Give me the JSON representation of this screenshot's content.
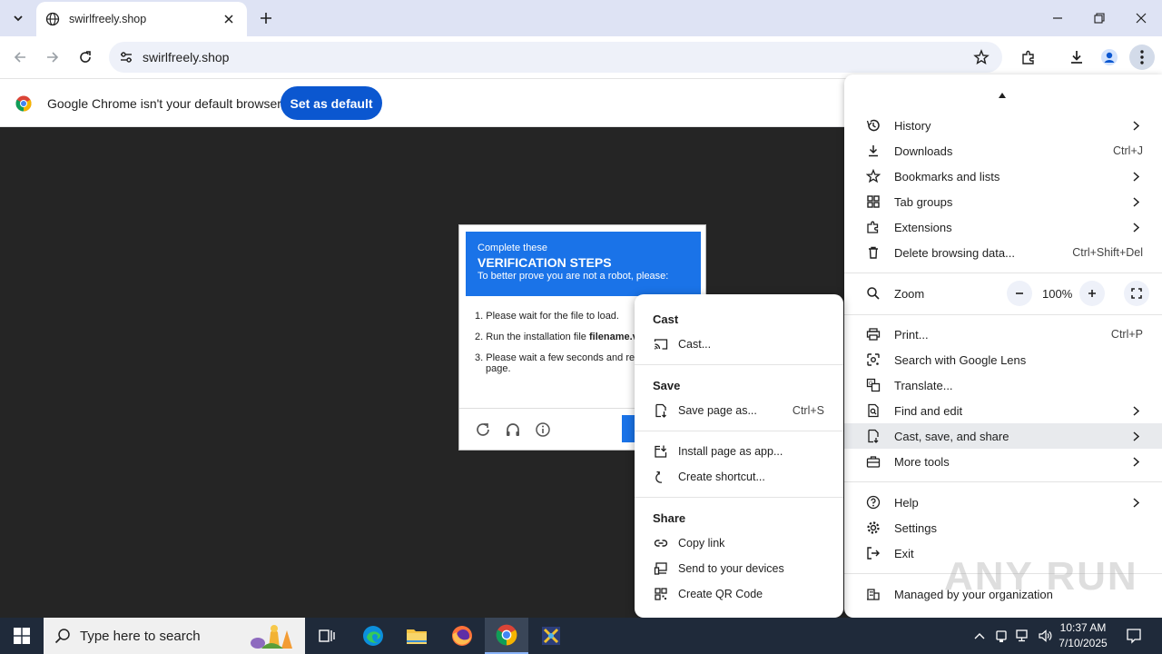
{
  "browser": {
    "tab_title": "swirlfreely.shop",
    "url": "swirlfreely.shop"
  },
  "infobar": {
    "message": "Google Chrome isn't your default browser",
    "button": "Set as default"
  },
  "captcha": {
    "header_line1": "Complete these",
    "header_line2": "VERIFICATION STEPS",
    "header_line3": "To better prove you are not a robot, please:",
    "step1": "1. Please wait for the file to load.",
    "step2_prefix": "2. Run the installation file ",
    "step2_bold": "filename.v",
    "step3_line1": "3. Please wait a few seconds and rel",
    "step3_line2": "page."
  },
  "main_menu": {
    "items": [
      {
        "label": "History",
        "shortcut": "",
        "icon": "history-icon"
      },
      {
        "label": "Downloads",
        "shortcut": "Ctrl+J",
        "icon": "download-icon"
      },
      {
        "label": "Bookmarks and lists",
        "shortcut": "",
        "icon": "star-icon"
      },
      {
        "label": "Tab groups",
        "shortcut": "",
        "icon": "tab-groups-icon"
      },
      {
        "label": "Extensions",
        "shortcut": "",
        "icon": "puzzle-icon"
      },
      {
        "label": "Delete browsing data...",
        "shortcut": "Ctrl+Shift+Del",
        "icon": "trash-icon"
      },
      {
        "label": "Zoom",
        "shortcut": "",
        "icon": "zoom-icon"
      },
      {
        "label": "Print...",
        "shortcut": "Ctrl+P",
        "icon": "print-icon"
      },
      {
        "label": "Search with Google Lens",
        "shortcut": "",
        "icon": "lens-icon"
      },
      {
        "label": "Translate...",
        "shortcut": "",
        "icon": "translate-icon"
      },
      {
        "label": "Find and edit",
        "shortcut": "",
        "icon": "find-icon"
      },
      {
        "label": "Cast, save, and share",
        "shortcut": "",
        "icon": "cast-save-icon"
      },
      {
        "label": "More tools",
        "shortcut": "",
        "icon": "toolbox-icon"
      },
      {
        "label": "Help",
        "shortcut": "",
        "icon": "help-icon"
      },
      {
        "label": "Settings",
        "shortcut": "",
        "icon": "gear-icon"
      },
      {
        "label": "Exit",
        "shortcut": "",
        "icon": "exit-icon"
      },
      {
        "label": "Managed by your organization",
        "shortcut": "",
        "icon": "building-icon"
      }
    ],
    "zoom_value": "100%"
  },
  "submenu": {
    "cast_header": "Cast",
    "cast_item": "Cast...",
    "save_header": "Save",
    "save_page": "Save page as...",
    "save_page_shortcut": "Ctrl+S",
    "install_app": "Install page as app...",
    "create_shortcut": "Create shortcut...",
    "share_header": "Share",
    "copy_link": "Copy link",
    "send_devices": "Send to your devices",
    "qr_code": "Create QR Code"
  },
  "taskbar": {
    "search_placeholder": "Type here to search",
    "time": "10:37 AM",
    "date": "7/10/2025"
  },
  "watermark": "ANY RUN",
  "colors": {
    "accent": "#0b57d0",
    "tabstrip": "#dee3f4",
    "captcha_blue": "#1a73e8",
    "taskbar": "#1f2a3a"
  }
}
